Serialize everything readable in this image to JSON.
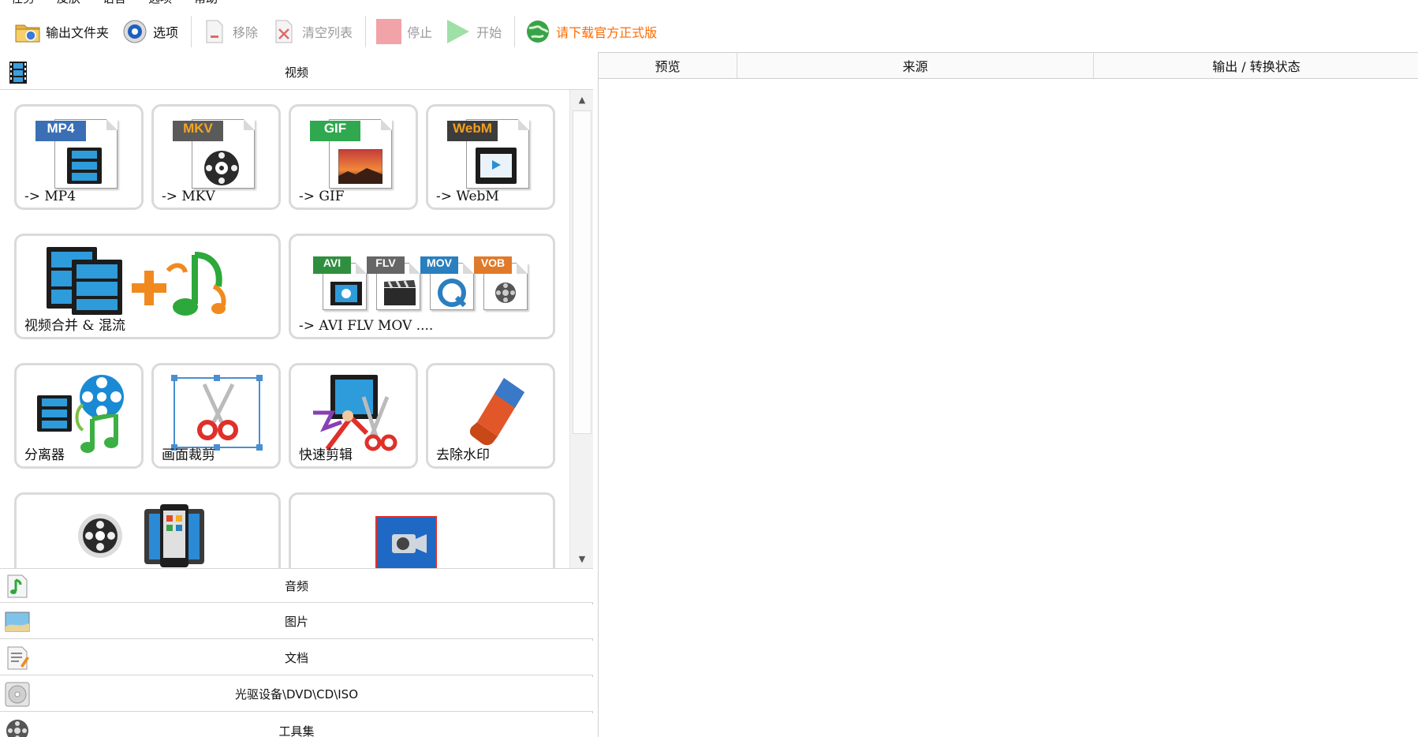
{
  "menu": [
    "任务",
    "皮肤",
    "语言",
    "选项",
    "帮助"
  ],
  "toolbar": {
    "output_folder": "输出文件夹",
    "options": "选项",
    "remove": "移除",
    "clear_list": "清空列表",
    "stop": "停止",
    "start": "开始",
    "download": "请下载官方正式版"
  },
  "categories": {
    "video": "视频",
    "audio": "音频",
    "image": "图片",
    "document": "文档",
    "disc": "光驱设备\\DVD\\CD\\ISO",
    "tools": "工具集"
  },
  "tiles": {
    "mp4": {
      "label": "-> MP4",
      "badge": "MP4"
    },
    "mkv": {
      "label": "-> MKV",
      "badge": "MKV"
    },
    "gif": {
      "label": "-> GIF",
      "badge": "GIF"
    },
    "webm": {
      "label": "-> WebM",
      "badge": "WebM"
    },
    "merge": {
      "label": "视频合并 & 混流"
    },
    "multi": {
      "label": "-> AVI FLV MOV ....",
      "badges": [
        "AVI",
        "FLV",
        "MOV",
        "VOB"
      ]
    },
    "splitter": {
      "label": "分离器"
    },
    "crop": {
      "label": "画面裁剪"
    },
    "quickcut": {
      "label": "快速剪辑"
    },
    "watermark": {
      "label": "去除水印"
    }
  },
  "columns": {
    "preview": "预览",
    "source": "来源",
    "output": "输出 / 转换状态"
  },
  "colors": {
    "promo": "#ff6a00",
    "mp4_badge": "#3a6fb5",
    "mkv_badge": "#5a5a5a",
    "gif_badge": "#2fa84f",
    "webm_badge": "#3c3c3c",
    "avi_badge": "#2f8f3f",
    "flv_badge": "#666666",
    "mov_badge": "#2a7fbf",
    "vob_badge": "#e07a2a"
  }
}
